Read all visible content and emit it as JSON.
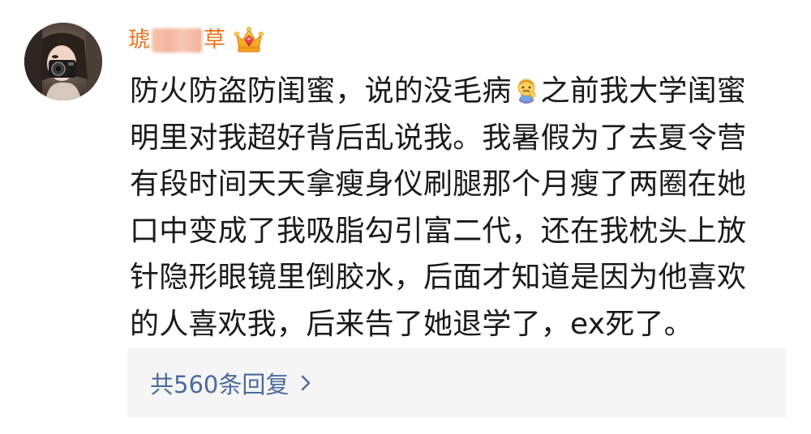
{
  "comment": {
    "username_prefix": "琥",
    "username_suffix": "草",
    "text_lines": [
      {
        "before": "防火防盗防闺蜜，说的没毛病",
        "emoji": "thinking-doll-emoji",
        "after": "之前我大学闺蜜"
      },
      {
        "text": "明里对我超好背后乱说我。我暑假为了去夏令营"
      },
      {
        "text": "有段时间天天拿瘦身仪刷腿那个月瘦了两圈在她"
      },
      {
        "text": "口中变成了我吸脂勾引富二代，还在我枕头上放"
      },
      {
        "text": "针隐形眼镜里倒胶水，后面才知道是因为他喜欢"
      },
      {
        "text": "的人喜欢我，后来告了她退学了，ex死了。"
      }
    ]
  },
  "replies": {
    "label": "共560条回复",
    "icon": "chevron-right-icon"
  },
  "colors": {
    "username": "#e8741e",
    "body_text": "#1a1a1a",
    "link": "#4a6a9c",
    "reply_bg": "#f5f5f5"
  }
}
